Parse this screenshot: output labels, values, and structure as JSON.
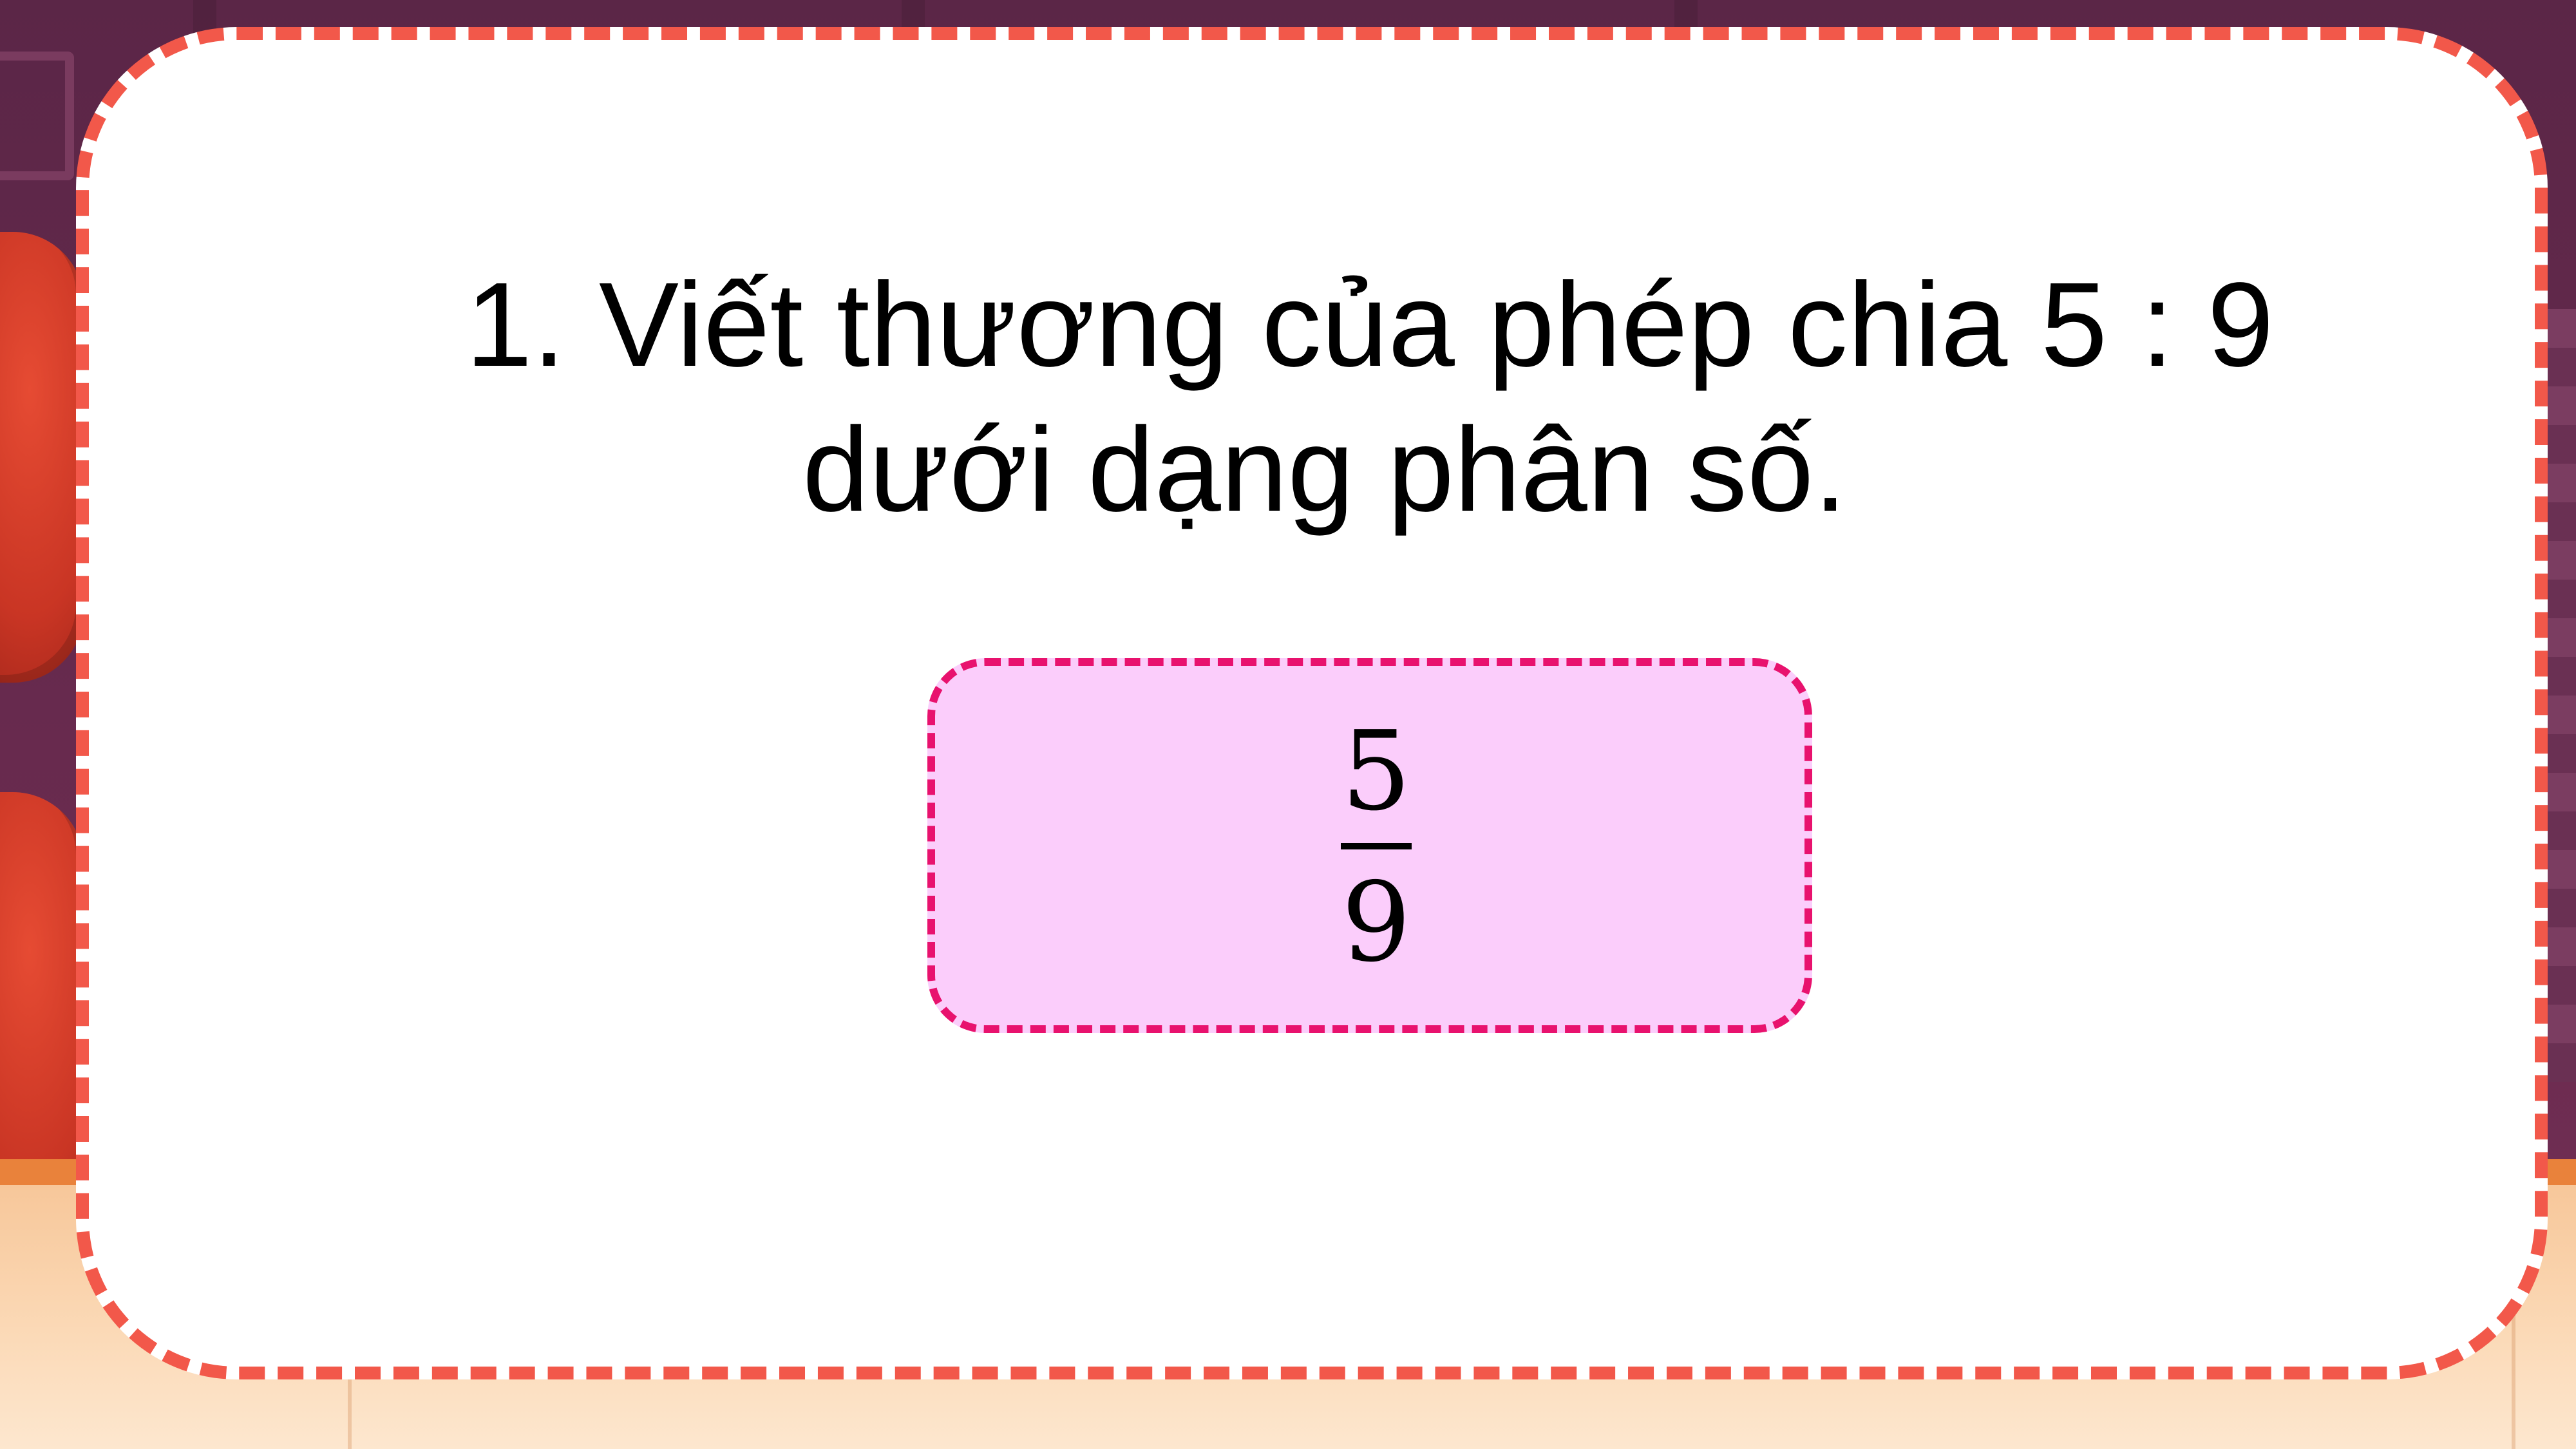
{
  "question": {
    "line1": "1. Viết thương của phép chia 5 : 9",
    "line2": "dưới dạng phân số."
  },
  "answer": {
    "numerator": "5",
    "denominator": "9"
  },
  "colors": {
    "card_border": "#f2584a",
    "answer_border": "#e8126e",
    "answer_fill": "#fbcdfb",
    "background_wall": "#5b2647",
    "stage_edge": "#e9823b",
    "floor": "#fbd9b6"
  }
}
